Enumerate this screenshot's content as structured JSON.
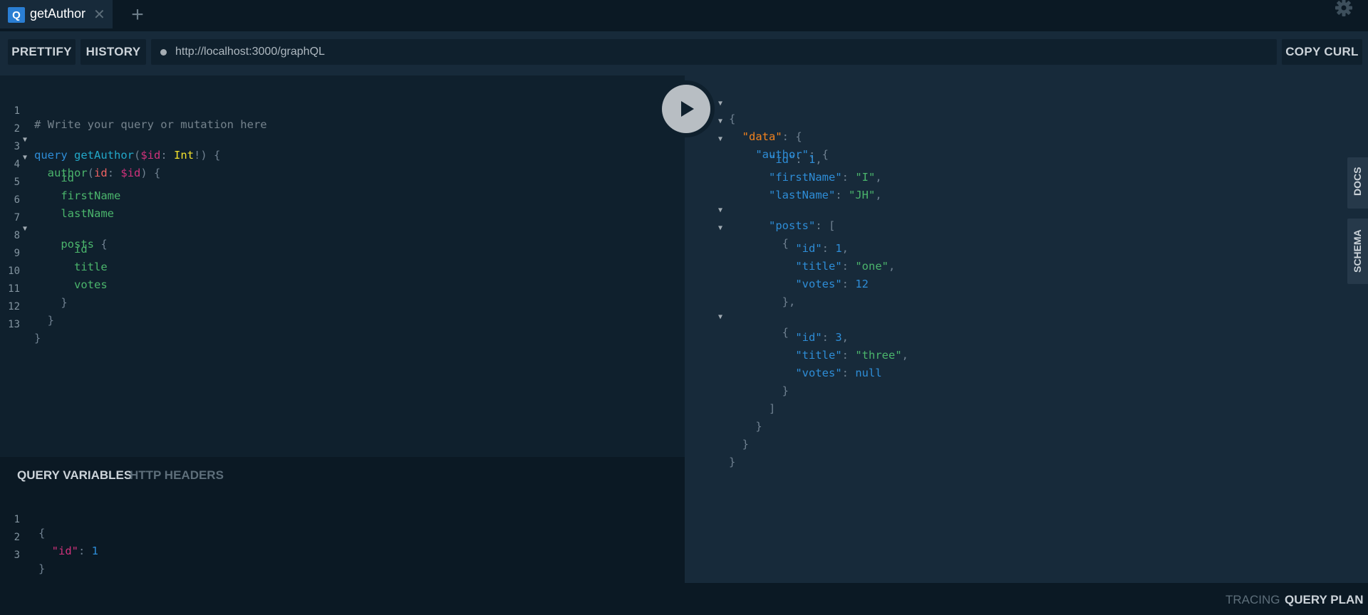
{
  "tabs": [
    {
      "badge": "Q",
      "title": "getAuthor",
      "close": "✕"
    }
  ],
  "tab_add": "+",
  "toolbar": {
    "prettify": "PRETTIFY",
    "history": "HISTORY",
    "url": "http://localhost:3000/graphQL",
    "copy_curl": "COPY CURL"
  },
  "editor": {
    "line_numbers": [
      "1",
      "2",
      "3",
      "4",
      "5",
      "6",
      "7",
      "8",
      "9",
      "10",
      "11",
      "12",
      "13"
    ],
    "comment": "# Write your query or mutation here",
    "kw_query": "query",
    "op_name": "getAuthor",
    "var_id": "$id",
    "type_int": "Int",
    "field_author": "author",
    "arg_id": "id",
    "f_id": "id",
    "f_firstName": "firstName",
    "f_lastName": "lastName",
    "f_posts": "posts",
    "f_title": "title",
    "f_votes": "votes"
  },
  "variables": {
    "tab_query_variables": "QUERY VARIABLES",
    "tab_http_headers": "HTTP HEADERS",
    "line_numbers": [
      "1",
      "2",
      "3"
    ],
    "key": "\"id\"",
    "value": "1"
  },
  "result": {
    "k_data": "\"data\"",
    "k_author": "\"author\"",
    "k_id": "\"id\"",
    "k_firstName": "\"firstName\"",
    "k_lastName": "\"lastName\"",
    "k_posts": "\"posts\"",
    "k_title": "\"title\"",
    "k_votes": "\"votes\"",
    "author_id": "1",
    "firstName": "\"I\"",
    "lastName": "\"JH\"",
    "posts": [
      {
        "id": "1",
        "title": "\"one\"",
        "votes": "12"
      },
      {
        "id": "3",
        "title": "\"three\"",
        "votes": "null"
      }
    ]
  },
  "side_tabs": {
    "docs": "DOCS",
    "schema": "SCHEMA"
  },
  "footer": {
    "tracing": "TRACING",
    "query_plan": "QUERY PLAN"
  },
  "colors": {
    "accent": "#2a7ed3",
    "background": "#0f202d",
    "panel": "#172a3a"
  }
}
